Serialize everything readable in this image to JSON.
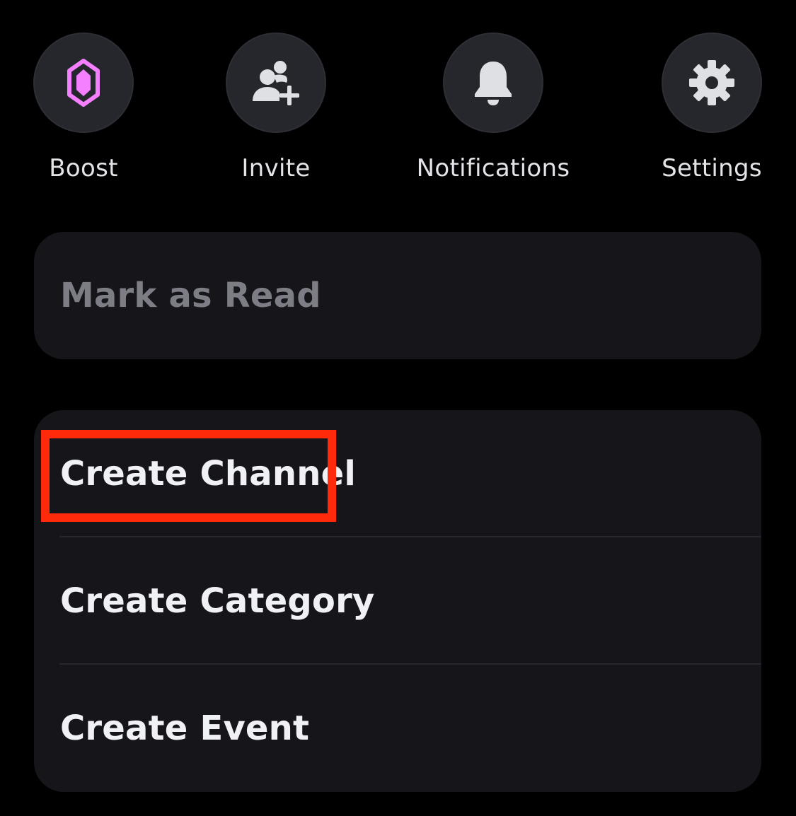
{
  "actions": {
    "boost": {
      "label": "Boost",
      "icon": "boost-gem-icon",
      "icon_color": "#f47fff"
    },
    "invite": {
      "label": "Invite",
      "icon": "add-person-icon",
      "icon_color": "#dfe0e4"
    },
    "notifications": {
      "label": "Notifications",
      "icon": "bell-icon",
      "icon_color": "#dfe0e4"
    },
    "settings": {
      "label": "Settings",
      "icon": "gear-icon",
      "icon_color": "#dfe0e4"
    }
  },
  "mark_as_read": {
    "label": "Mark as Read"
  },
  "create_menu": {
    "items": [
      {
        "label": "Create Channel"
      },
      {
        "label": "Create Category"
      },
      {
        "label": "Create Event"
      }
    ]
  },
  "colors": {
    "background": "#000000",
    "card": "#16161a",
    "circle": "#26272c",
    "highlight": "#ff2a0a"
  }
}
